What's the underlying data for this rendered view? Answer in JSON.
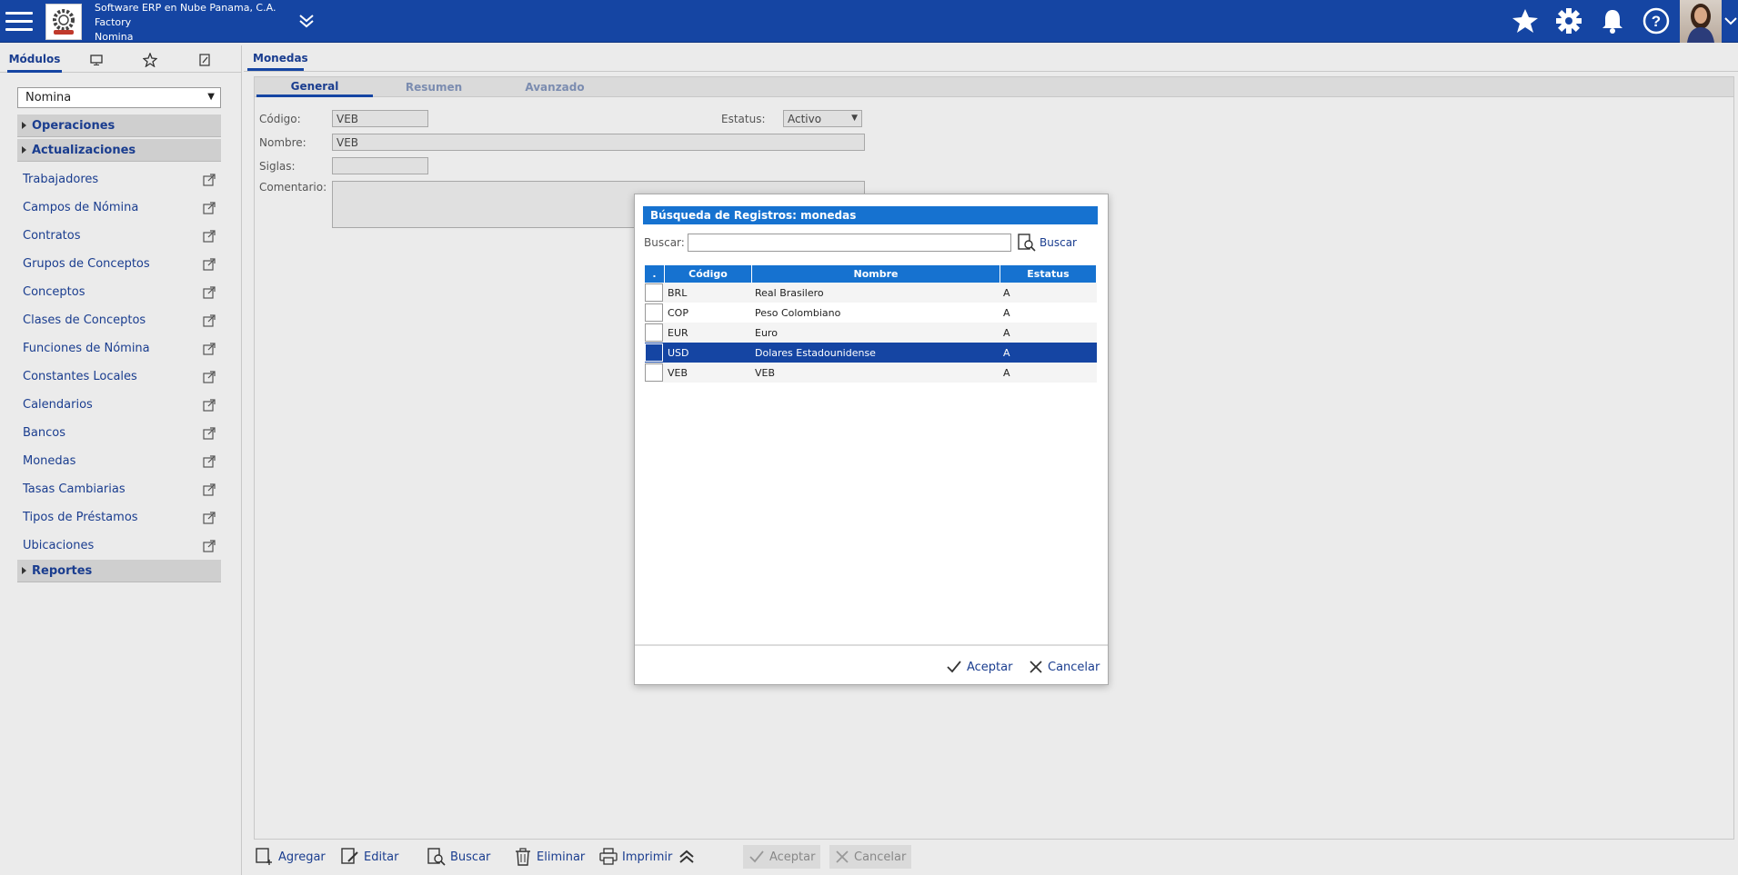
{
  "header": {
    "company_line1": "Software ERP en Nube Panama, C.A.",
    "company_line2": "Factory",
    "company_line3": "Nomina",
    "icons": [
      "menu-icon",
      "chevrons-down-icon",
      "star-icon",
      "gear-icon",
      "bell-icon",
      "help-icon"
    ],
    "brand_color": "#1545a3"
  },
  "sidebar": {
    "tab_label": "Módulos",
    "module_select": "Nomina",
    "sections": {
      "operaciones": "Operaciones",
      "actualizaciones": "Actualizaciones",
      "reportes": "Reportes"
    },
    "items": [
      "Trabajadores",
      "Campos de Nómina",
      "Contratos",
      "Grupos de Conceptos",
      "Conceptos",
      "Clases de Conceptos",
      "Funciones de Nómina",
      "Constantes Locales",
      "Calendarios",
      "Bancos",
      "Monedas",
      "Tasas Cambiarias",
      "Tipos de Préstamos",
      "Ubicaciones"
    ]
  },
  "main": {
    "tab_label": "Monedas",
    "form_tabs": [
      "General",
      "Resumen",
      "Avanzado"
    ],
    "form": {
      "codigo_label": "Código:",
      "codigo_value": "VEB",
      "estatus_label": "Estatus:",
      "estatus_value": "Activo",
      "nombre_label": "Nombre:",
      "nombre_value": "VEB",
      "siglas_label": "Siglas:",
      "siglas_value": "",
      "comentario_label": "Comentario:",
      "comentario_value": ""
    }
  },
  "toolbar": {
    "agregar": "Agregar",
    "editar": "Editar",
    "buscar": "Buscar",
    "eliminar": "Eliminar",
    "imprimir": "Imprimir",
    "aceptar": "Aceptar",
    "cancelar": "Cancelar"
  },
  "modal": {
    "title": "Búsqueda de Registros: monedas",
    "search_label": "Buscar:",
    "search_value": "",
    "search_button": "Buscar",
    "columns": [
      ".",
      "Código",
      "Nombre",
      "Estatus"
    ],
    "rows": [
      {
        "codigo": "BRL",
        "nombre": "Real Brasilero",
        "estatus": "A"
      },
      {
        "codigo": "COP",
        "nombre": "Peso Colombiano",
        "estatus": "A"
      },
      {
        "codigo": "EUR",
        "nombre": "Euro",
        "estatus": "A"
      },
      {
        "codigo": "USD",
        "nombre": "Dolares Estadounidense",
        "estatus": "A"
      },
      {
        "codigo": "VEB",
        "nombre": "VEB",
        "estatus": "A"
      }
    ],
    "selected_row": "USD",
    "accept": "Aceptar",
    "cancel": "Cancelar"
  }
}
